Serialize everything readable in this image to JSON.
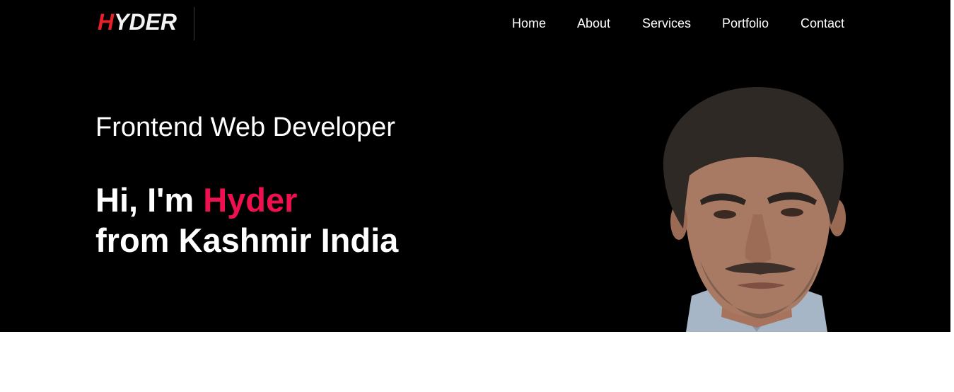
{
  "brand": {
    "logo_first": "H",
    "logo_rest": "YDER"
  },
  "nav": {
    "items": [
      {
        "label": "Home"
      },
      {
        "label": "About"
      },
      {
        "label": "Services"
      },
      {
        "label": "Portfolio"
      },
      {
        "label": "Contact"
      }
    ]
  },
  "hero": {
    "subtitle": "Frontend Web Developer",
    "greeting": "Hi, I'm ",
    "name": "Hyder",
    "location_line": "from Kashmir India"
  },
  "colors": {
    "background": "#000000",
    "accent": "#f0104f",
    "logo_accent": "#e8202a",
    "text": "#ffffff"
  }
}
